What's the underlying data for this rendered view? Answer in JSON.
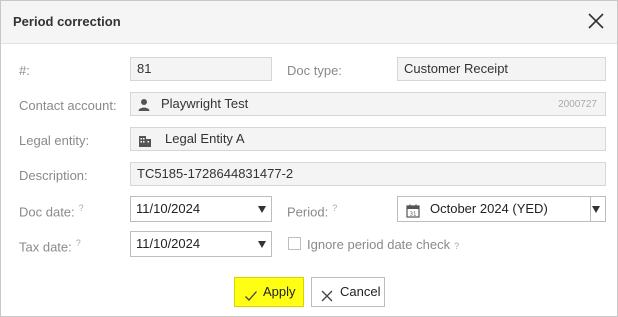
{
  "dialog": {
    "title": "Period correction",
    "close_icon": "close-icon"
  },
  "fields": {
    "number": {
      "label": "#:",
      "value": "81"
    },
    "doc_type": {
      "label": "Doc type:",
      "value": "Customer Receipt"
    },
    "contact_account": {
      "label": "Contact account:",
      "value": "Playwright Test",
      "code": "2000727",
      "icon": "person-icon"
    },
    "legal_entity": {
      "label": "Legal entity:",
      "value": "Legal Entity A",
      "icon": "building-icon"
    },
    "description": {
      "label": "Description:",
      "value": "TC5185-1728644831477-2"
    },
    "doc_date": {
      "label": "Doc date:",
      "help": "?",
      "value": "11/10/2024"
    },
    "period": {
      "label": "Period:",
      "help": "?",
      "value": "October 2024 (YED)",
      "icon": "calendar-icon",
      "calendar_day": "31"
    },
    "tax_date": {
      "label": "Tax date:",
      "help": "?",
      "value": "11/10/2024"
    },
    "ignore_period": {
      "label": "Ignore period date check",
      "help": "?",
      "checked": false
    }
  },
  "buttons": {
    "apply": {
      "label": "Apply",
      "icon": "checkmark-icon",
      "color": "#ffff14"
    },
    "cancel": {
      "label": "Cancel",
      "icon": "close-icon"
    }
  }
}
